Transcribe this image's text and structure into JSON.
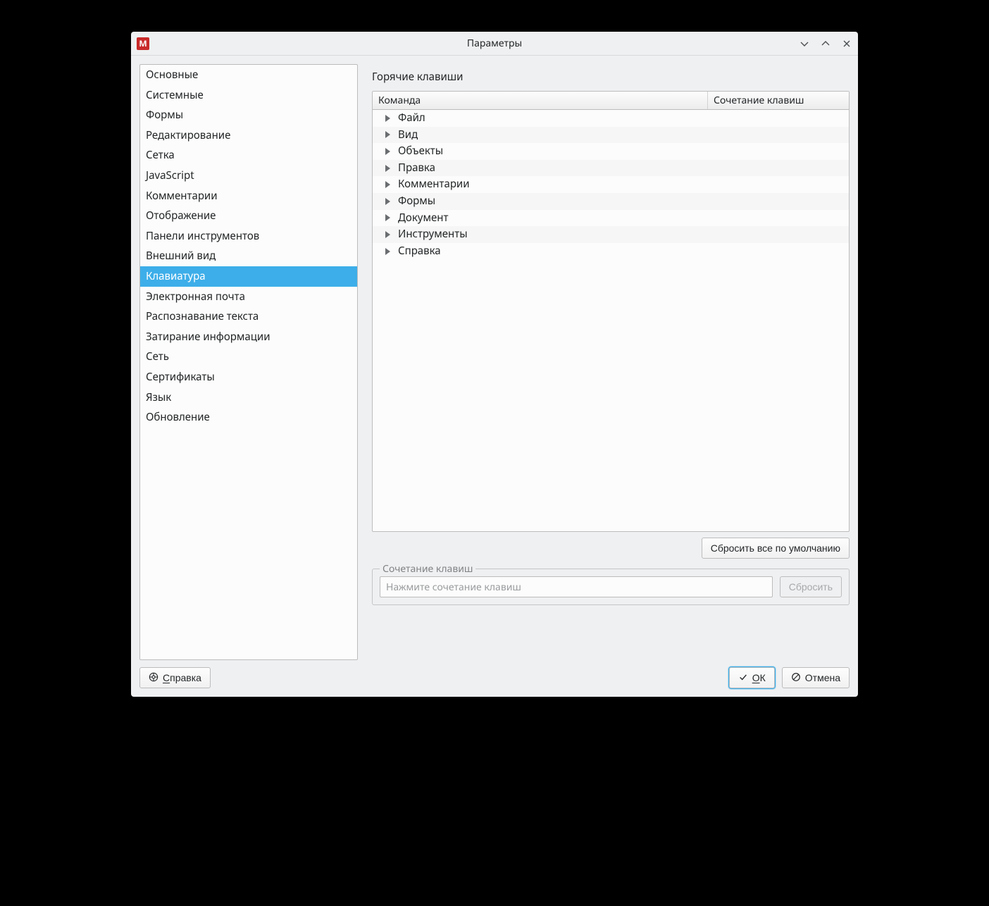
{
  "window": {
    "title": "Параметры"
  },
  "sidebar": {
    "items": [
      "Основные",
      "Системные",
      "Формы",
      "Редактирование",
      "Сетка",
      "JavaScript",
      "Комментарии",
      "Отображение",
      "Панели инструментов",
      "Внешний вид",
      "Клавиатура",
      "Электронная почта",
      "Распознавание текста",
      "Затирание информации",
      "Сеть",
      "Сертификаты",
      "Язык",
      "Обновление"
    ],
    "selected_index": 10
  },
  "main": {
    "section_title": "Горячие клавиши",
    "columns": {
      "command": "Команда",
      "shortcut": "Сочетание клавиш"
    },
    "categories": [
      "Файл",
      "Вид",
      "Объекты",
      "Правка",
      "Комментарии",
      "Формы",
      "Документ",
      "Инструменты",
      "Справка"
    ],
    "reset_all_btn": "Сбросить все по умолчанию",
    "group_label": "Сочетание клавиш",
    "input_placeholder": "Нажмите сочетание клавиш",
    "reset_btn": "Сбросить"
  },
  "footer": {
    "help_prefix": "С",
    "help_rest": "правка",
    "ok_prefix": "О",
    "ok_rest": "К",
    "cancel": "Отмена"
  }
}
